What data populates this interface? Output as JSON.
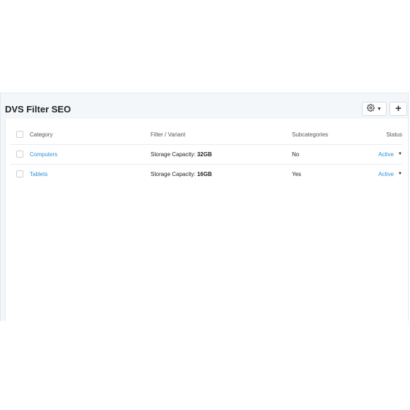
{
  "panel": {
    "title": "DVS Filter SEO",
    "gear_icon": "gear-icon",
    "add_icon": "plus-icon",
    "add_label": "+"
  },
  "table": {
    "columns": [
      "Category",
      "Filter / Variant",
      "Subcategories",
      "Status"
    ],
    "rows": [
      {
        "category": "Computers",
        "filter_name": "Storage Capacity:",
        "filter_value": "32GB",
        "subcategories": "No",
        "status": "Active"
      },
      {
        "category": "Tablets",
        "filter_name": "Storage Capacity:",
        "filter_value": "16GB",
        "subcategories": "Yes",
        "status": "Active"
      }
    ]
  },
  "colors": {
    "link": "#2f8fd6",
    "panel_bg": "#f4f7fa",
    "border": "#e3e8ee"
  }
}
